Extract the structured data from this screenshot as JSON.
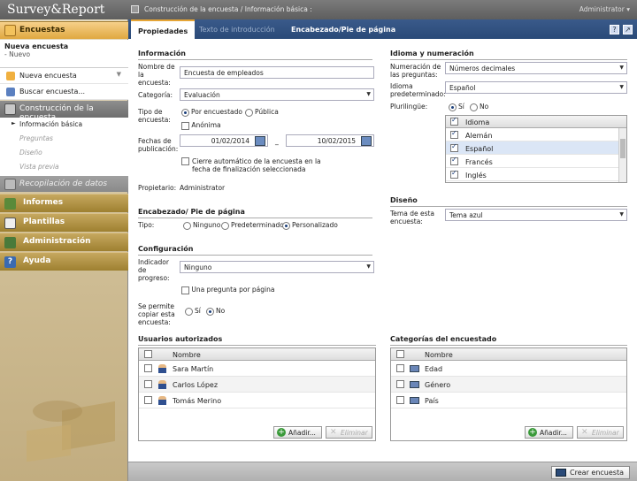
{
  "app": {
    "logo": "Survey&Report",
    "breadcrumb": "Construcción de la encuesta / Información básica :",
    "user": "Administrator"
  },
  "sidebar": {
    "encuestas": "Encuestas",
    "current": {
      "title": "Nueva encuesta",
      "subtitle": "- Nuevo"
    },
    "menu": [
      {
        "label": "Nueva encuesta"
      },
      {
        "label": "Buscar encuesta..."
      }
    ],
    "construccion": "Construcción de la encuesta",
    "sub": [
      "Información básica",
      "Preguntas",
      "Diseño",
      "Vista previa"
    ],
    "recopilacion": "Recopilación de datos",
    "sections": [
      "Informes",
      "Plantillas",
      "Administración",
      "Ayuda"
    ]
  },
  "tabs": [
    "Propiedades",
    "Texto de introducción",
    "Encabezado/Pie de página"
  ],
  "info": {
    "title": "Información",
    "name_label": "Nombre de la encuesta:",
    "name_value": "Encuesta de empleados",
    "cat_label": "Categoría:",
    "cat_value": "Evaluación",
    "type_label": "Tipo de encuesta:",
    "type_opt1": "Por encuestado",
    "type_opt2": "Pública",
    "anon": "Anónima",
    "dates_label": "Fechas de publicación:",
    "date_from": "01/02/2014",
    "date_to": "10/02/2015",
    "date_sep": "_",
    "autoclose": "Cierre automático de la encuesta en la fecha de finalización seleccionada",
    "owner_label": "Propietario:",
    "owner_value": "Administrator"
  },
  "header_footer": {
    "title": "Encabezado/ Pie de página",
    "type_label": "Tipo:",
    "opt1": "Ninguno",
    "opt2": "Predeterminado",
    "opt3": "Personalizado"
  },
  "config": {
    "title": "Configuración",
    "progress_label": "Indicador de progreso:",
    "progress_value": "Ninguno",
    "one_per_page": "Una pregunta por página",
    "copy_label": "Se permite copiar esta encuesta:",
    "yes": "Sí",
    "no": "No"
  },
  "lang": {
    "title": "Idioma y numeración",
    "num_label": "Numeración de las preguntas:",
    "num_value": "Números decimales",
    "default_label": "Idioma predeterminado:",
    "default_value": "Español",
    "multi_label": "Plurilingüe:",
    "yes": "Sí",
    "no": "No",
    "list_header": "Idioma",
    "languages": [
      "Alemán",
      "Español",
      "Francés",
      "Inglés"
    ]
  },
  "design": {
    "title": "Diseño",
    "theme_label": "Tema de esta encuesta:",
    "theme_value": "Tema azul"
  },
  "users": {
    "title": "Usuarios autorizados",
    "col": "Nombre",
    "rows": [
      "Sara Martín",
      "Carlos López",
      "Tomás Merino"
    ],
    "add": "Añadir...",
    "del": "Eliminar"
  },
  "cats": {
    "title": "Categorías del encuestado",
    "col": "Nombre",
    "rows": [
      "Edad",
      "Género",
      "País"
    ],
    "add": "Añadir...",
    "del": "Eliminar"
  },
  "footer": {
    "create": "Crear encuesta"
  },
  "colors": {
    "accent": "#e5a536",
    "tabbar": "#2a4a78",
    "section_gold": "#b0923f"
  }
}
